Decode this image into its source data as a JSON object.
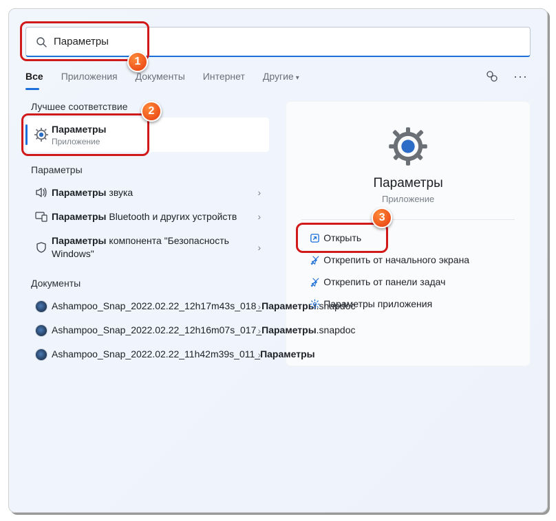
{
  "search": {
    "value": "Параметры"
  },
  "tabs": {
    "all": "Все",
    "apps": "Приложения",
    "docs": "Документы",
    "web": "Интернет",
    "more": "Другие"
  },
  "sections": {
    "best": "Лучшее соответствие",
    "settings": "Параметры",
    "documents": "Документы"
  },
  "bestMatch": {
    "title": "Параметры",
    "sub": "Приложение"
  },
  "settingsItems": {
    "0": {
      "pre": "Параметры",
      "post": " звука"
    },
    "1": {
      "pre": "Параметры",
      "post": " Bluetooth и других устройств"
    },
    "2": {
      "pre": "Параметры",
      "post": " компонента \"Безопасность Windows\""
    }
  },
  "docs": {
    "0": {
      "a": "Ashampoo_Snap_2022.02.22_12h17m43s_018_",
      "b": "Параметры",
      "c": ".snapdoc"
    },
    "1": {
      "a": "Ashampoo_Snap_2022.02.22_12h16m07s_017_",
      "b": "Параметры",
      "c": ".snapdoc"
    },
    "2": {
      "a": "Ashampoo_Snap_2022.02.22_11h42m39s_011_",
      "b": "Параметры",
      "c": ""
    }
  },
  "preview": {
    "title": "Параметры",
    "sub": "Приложение",
    "actions": {
      "open": "Открыть",
      "unpinStart": "Открепить от начального экрана",
      "unpinTaskbar": "Открепить от панели задач",
      "appSettings": "Параметры приложения"
    }
  }
}
